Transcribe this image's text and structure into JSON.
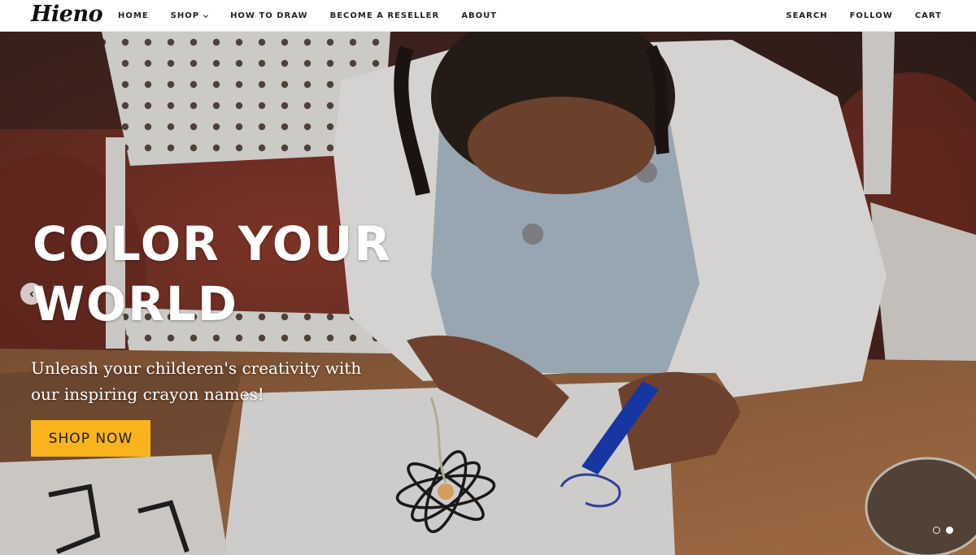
{
  "brand": {
    "logo_text": "Hieno"
  },
  "nav": {
    "left": [
      {
        "label": "HOME"
      },
      {
        "label": "SHOP",
        "has_dropdown": true
      },
      {
        "label": "HOW TO DRAW"
      },
      {
        "label": "BECOME A RESELLER"
      },
      {
        "label": "ABOUT"
      }
    ],
    "right": [
      {
        "label": "SEARCH"
      },
      {
        "label": "FOLLOW"
      },
      {
        "label": "CART"
      }
    ]
  },
  "hero": {
    "headline_line1": "COLOR YOUR",
    "headline_line2": "WORLD",
    "subtext": "Unleash your childeren's creativity with our inspiring crayon names!",
    "cta_label": "SHOP NOW",
    "slides": {
      "count": 2,
      "active_index": 1
    }
  },
  "colors": {
    "accent": "#f9b31c",
    "header_bg": "#ffffff",
    "nav_text": "#222222",
    "hero_text": "#ffffff"
  },
  "icons": {
    "prev": "chevron-left-icon",
    "dropdown": "chevron-down-icon"
  }
}
